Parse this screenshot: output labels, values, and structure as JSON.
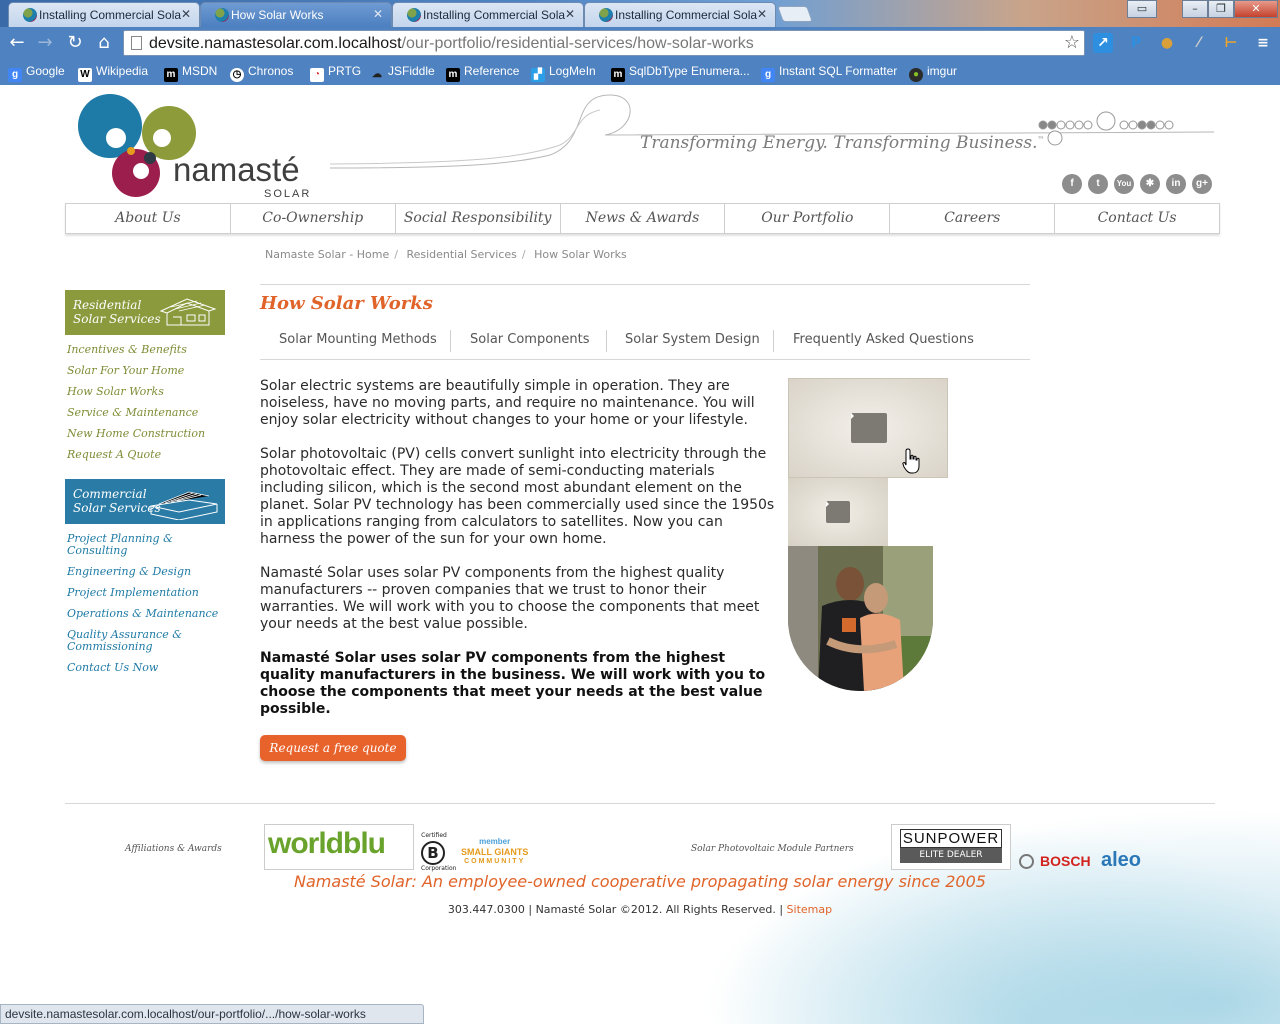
{
  "browser": {
    "tabs": [
      {
        "title": "Installing Commercial Sola",
        "active": false
      },
      {
        "title": "How Solar Works",
        "active": true
      },
      {
        "title": "Installing Commercial Sola",
        "active": false
      },
      {
        "title": "Installing Commercial Sola",
        "active": false
      }
    ],
    "url_host": "devsite.namastesolar.com.localhost",
    "url_path": "/our-portfolio/residential-services/how-solar-works",
    "bookmarks": [
      {
        "label": "Google",
        "icon": "google-icon"
      },
      {
        "label": "Wikipedia",
        "icon": "wikipedia-icon"
      },
      {
        "label": "MSDN",
        "icon": "msdn-icon"
      },
      {
        "label": "Chronos",
        "icon": "chronos-icon"
      },
      {
        "label": "PRTG",
        "icon": "prtg-icon"
      },
      {
        "label": "JSFiddle",
        "icon": "jsfiddle-icon"
      },
      {
        "label": "Reference",
        "icon": "reference-icon"
      },
      {
        "label": "LogMeIn",
        "icon": "logmein-icon"
      },
      {
        "label": "SqlDbType Enumera...",
        "icon": "msdn-icon"
      },
      {
        "label": "Instant SQL Formatter",
        "icon": "google-icon"
      },
      {
        "label": "imgur",
        "icon": "imgur-icon"
      }
    ],
    "status_url": "devsite.namastesolar.com.localhost/our-portfolio/.../how-solar-works"
  },
  "header": {
    "logo_name": "namasté",
    "logo_sub": "SOLAR",
    "tagline": "Transforming Energy. Transforming Business.",
    "tagline_tm": "™",
    "social": [
      "f",
      "t",
      "You",
      "✱",
      "in",
      "g+"
    ]
  },
  "nav": [
    "About Us",
    "Co-Ownership",
    "Social Responsibility",
    "News & Awards",
    "Our Portfolio",
    "Careers",
    "Contact Us"
  ],
  "breadcrumb": [
    "Namaste Solar - Home",
    "Residential Services",
    "How Solar Works"
  ],
  "sidebar": {
    "residential_title_1": "Residential",
    "residential_title_2": "Solar Services",
    "residential_links": [
      "Incentives & Benefits",
      "Solar For Your Home",
      "How Solar Works",
      "Service & Maintenance",
      "New Home Construction",
      "Request A Quote"
    ],
    "commercial_title_1": "Commercial",
    "commercial_title_2": "Solar Services",
    "commercial_links": [
      "Project Planning & Consulting",
      "Engineering & Design",
      "Project Implementation",
      "Operations & Maintenance",
      "Quality Assurance & Commissioning",
      "Contact Us Now"
    ]
  },
  "content": {
    "title": "How Solar Works",
    "subnav": [
      "Solar Mounting Methods",
      "Solar Components",
      "Solar System Design",
      "Frequently Asked Questions"
    ],
    "paragraphs": [
      "Solar electric systems are beautifully simple in operation. They are noiseless, have no moving parts, and require no maintenance. You will enjoy solar electricity without changes to your home or your lifestyle.",
      "Solar photovoltaic (PV) cells convert sunlight into electricity through the photovoltaic effect. They are made of semi-conducting materials including silicon, which is the second most abundant element on the planet. Solar PV technology has been commercially used since the 1950s in applications ranging from calculators to satellites. Now you can harness the power of the sun for your own home.",
      "Namasté Solar uses solar PV components from the highest quality manufacturers -- proven companies that we trust to honor their warranties. We will work with you to choose the components that meet your needs at the best value possible."
    ],
    "bold_paragraph": "Namasté Solar uses solar PV components from the highest quality manufacturers in the business. We will work with you to choose the components that meet your needs at the best value possible.",
    "quote_button": "Request a free quote"
  },
  "footer": {
    "affiliations_label": "Affiliations & Awards",
    "partners_label": "Solar Photovoltaic Module Partners",
    "worldblu": "worldblu",
    "bcorp_top": "Certified",
    "bcorp_letter": "B",
    "bcorp_bottom": "Corporation",
    "smallgiants_1": "member",
    "smallgiants_2": "SMALL GIANTS",
    "smallgiants_3": "COMMUNITY",
    "sunpower_1": "SUNPOWER",
    "sunpower_2": "ELITE DEALER",
    "bosch": "BOSCH",
    "aleo": "aleo",
    "slogan": "Namasté Solar: An employee-owned cooperative propagating solar energy since 2005",
    "copyright": "303.447.0300 | Namasté Solar ©2012. All Rights Reserved. |",
    "sitemap": "Sitemap"
  },
  "colors": {
    "accent_orange": "#e0642a",
    "residential_green": "#8a9a3c",
    "commercial_blue": "#2a7ba6",
    "chrome_blue": "#4f82c0"
  }
}
